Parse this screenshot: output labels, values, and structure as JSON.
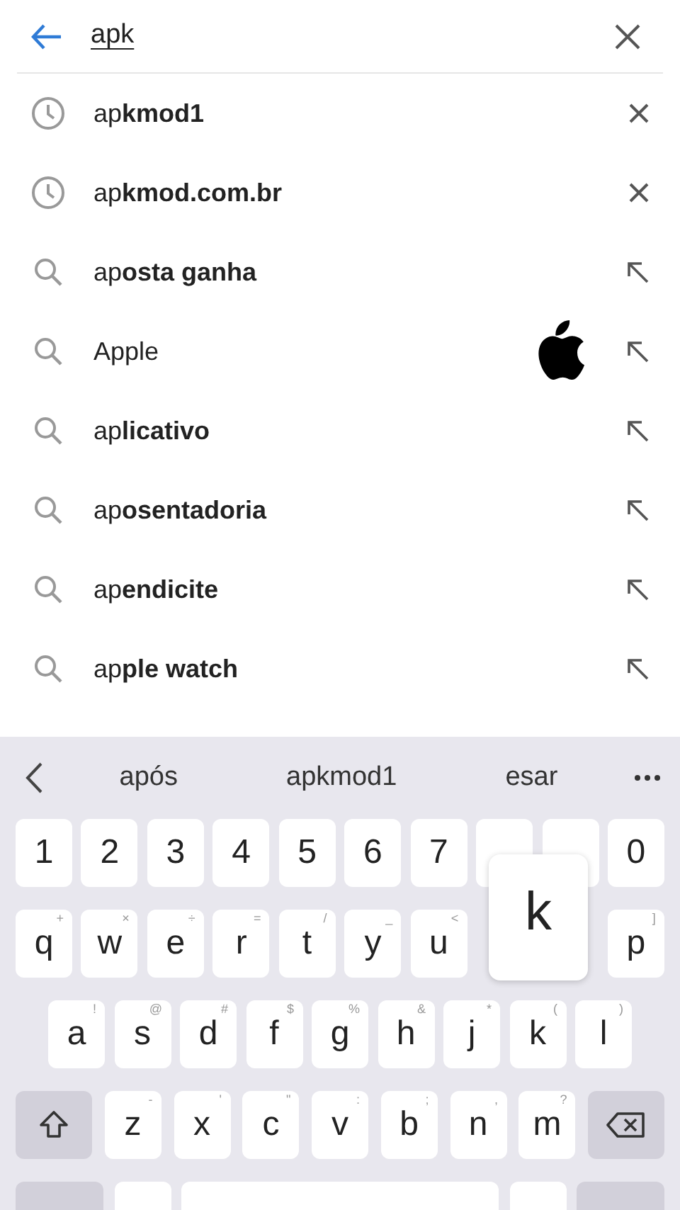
{
  "search": {
    "value": "apk"
  },
  "suggestions": [
    {
      "kind": "history",
      "text": "ap**kmod1**"
    },
    {
      "kind": "history",
      "text": "ap**kmod.com.br**"
    },
    {
      "kind": "query",
      "text": "ap**osta ganha**"
    },
    {
      "kind": "query",
      "text": "Apple"
    },
    {
      "kind": "query",
      "text": "ap**licativo**"
    },
    {
      "kind": "query",
      "text": "ap**osentadoria**"
    },
    {
      "kind": "query",
      "text": "ap**endicite**"
    },
    {
      "kind": "query",
      "text": "ap**ple watch**"
    }
  ],
  "keyboard": {
    "candidates": [
      "após",
      "apkmod1",
      "esar"
    ],
    "popup": {
      "label": "k"
    },
    "rows": [
      {
        "keys": [
          {
            "kind": "char",
            "label": "1"
          },
          {
            "kind": "char",
            "label": "2"
          },
          {
            "kind": "char",
            "label": "3"
          },
          {
            "kind": "char",
            "label": "4"
          },
          {
            "kind": "char",
            "label": "5"
          },
          {
            "kind": "char",
            "label": "6"
          },
          {
            "kind": "char",
            "label": "7"
          },
          {
            "kind": "covered"
          },
          {
            "kind": "covered"
          },
          {
            "kind": "char",
            "label": "0"
          }
        ]
      },
      {
        "keys": [
          {
            "kind": "char",
            "label": "q",
            "hint": "+"
          },
          {
            "kind": "char",
            "label": "w",
            "hint": "×"
          },
          {
            "kind": "char",
            "label": "e",
            "hint": "÷"
          },
          {
            "kind": "char",
            "label": "r",
            "hint": "="
          },
          {
            "kind": "char",
            "label": "t",
            "hint": "/"
          },
          {
            "kind": "char",
            "label": "y",
            "hint": "_"
          },
          {
            "kind": "char",
            "label": "u",
            "hint": "<"
          },
          {
            "kind": "covered"
          },
          {
            "kind": "covered"
          },
          {
            "kind": "char",
            "label": "p",
            "hint": "]"
          }
        ]
      },
      {
        "keys": [
          {
            "kind": "char",
            "label": "a",
            "hint": "!"
          },
          {
            "kind": "char",
            "label": "s",
            "hint": "@"
          },
          {
            "kind": "char",
            "label": "d",
            "hint": "#"
          },
          {
            "kind": "char",
            "label": "f",
            "hint": "$"
          },
          {
            "kind": "char",
            "label": "g",
            "hint": "%"
          },
          {
            "kind": "char",
            "label": "h",
            "hint": "&"
          },
          {
            "kind": "char",
            "label": "j",
            "hint": "*"
          },
          {
            "kind": "char",
            "label": "k",
            "hint": "("
          },
          {
            "kind": "char",
            "label": "l",
            "hint": ")"
          }
        ]
      },
      {
        "keys": [
          {
            "kind": "shift"
          },
          {
            "kind": "char",
            "label": "z",
            "hint": "-"
          },
          {
            "kind": "char",
            "label": "x",
            "hint": "'"
          },
          {
            "kind": "char",
            "label": "c",
            "hint": "\""
          },
          {
            "kind": "char",
            "label": "v",
            "hint": ":"
          },
          {
            "kind": "char",
            "label": "b",
            "hint": ";"
          },
          {
            "kind": "char",
            "label": "n",
            "hint": ","
          },
          {
            "kind": "char",
            "label": "m",
            "hint": "?"
          },
          {
            "kind": "backspace"
          }
        ]
      },
      {
        "keys": [
          {
            "kind": "function"
          },
          {
            "kind": "blank"
          },
          {
            "kind": "space"
          },
          {
            "kind": "blank"
          },
          {
            "kind": "enter"
          }
        ]
      }
    ]
  }
}
